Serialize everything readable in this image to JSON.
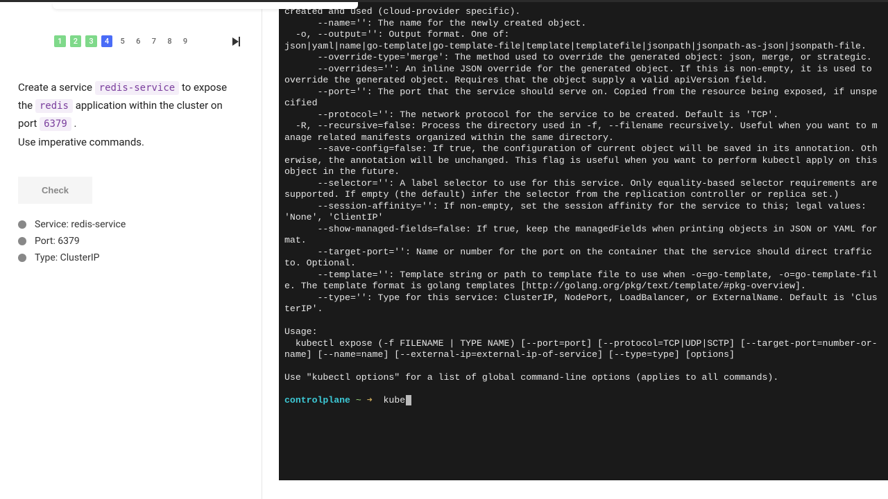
{
  "steps": {
    "items": [
      "1",
      "2",
      "3",
      "4",
      "5",
      "6",
      "7",
      "8",
      "9"
    ],
    "done": [
      0,
      1,
      2
    ],
    "current": 3
  },
  "instructions": {
    "pre1": "Create a service ",
    "code_service": "redis-service",
    "mid1": " to expose the ",
    "code_app": "redis",
    "mid2": " application within the cluster on port ",
    "code_port": "6379",
    "post": " .",
    "line2": "Use imperative commands."
  },
  "check_button": "Check",
  "checks": [
    "Service: redis-service",
    "Port: 6379",
    "Type: ClusterIP"
  ],
  "terminal": {
    "body": "created and used (cloud-provider specific).\n      --name='': The name for the newly created object.\n  -o, --output='': Output format. One of:\njson|yaml|name|go-template|go-template-file|template|templatefile|jsonpath|jsonpath-as-json|jsonpath-file.\n      --override-type='merge': The method used to override the generated object: json, merge, or strategic.\n      --overrides='': An inline JSON override for the generated object. If this is non-empty, it is used to override the generated object. Requires that the object supply a valid apiVersion field.\n      --port='': The port that the service should serve on. Copied from the resource being exposed, if unspecified\n      --protocol='': The network protocol for the service to be created. Default is 'TCP'.\n  -R, --recursive=false: Process the directory used in -f, --filename recursively. Useful when you want to manage related manifests organized within the same directory.\n      --save-config=false: If true, the configuration of current object will be saved in its annotation. Otherwise, the annotation will be unchanged. This flag is useful when you want to perform kubectl apply on this object in the future.\n      --selector='': A label selector to use for this service. Only equality-based selector requirements are supported. If empty (the default) infer the selector from the replication controller or replica set.)\n      --session-affinity='': If non-empty, set the session affinity for the service to this; legal values: 'None', 'ClientIP'\n      --show-managed-fields=false: If true, keep the managedFields when printing objects in JSON or YAML format.\n      --target-port='': Name or number for the port on the container that the service should direct traffic to. Optional.\n      --template='': Template string or path to template file to use when -o=go-template, -o=go-template-file. The template format is golang templates [http://golang.org/pkg/text/template/#pkg-overview].\n      --type='': Type for this service: ClusterIP, NodePort, LoadBalancer, or ExternalName. Default is 'ClusterIP'.\n\nUsage:\n  kubectl expose (-f FILENAME | TYPE NAME) [--port=port] [--protocol=TCP|UDP|SCTP] [--target-port=number-or-name] [--name=name] [--external-ip=external-ip-of-service] [--type=type] [options]\n\nUse \"kubectl options\" for a list of global command-line options (applies to all commands).\n",
    "prompt_host": "controlplane",
    "prompt_path": "~",
    "prompt_symbol": "➜",
    "typed": "kube"
  }
}
